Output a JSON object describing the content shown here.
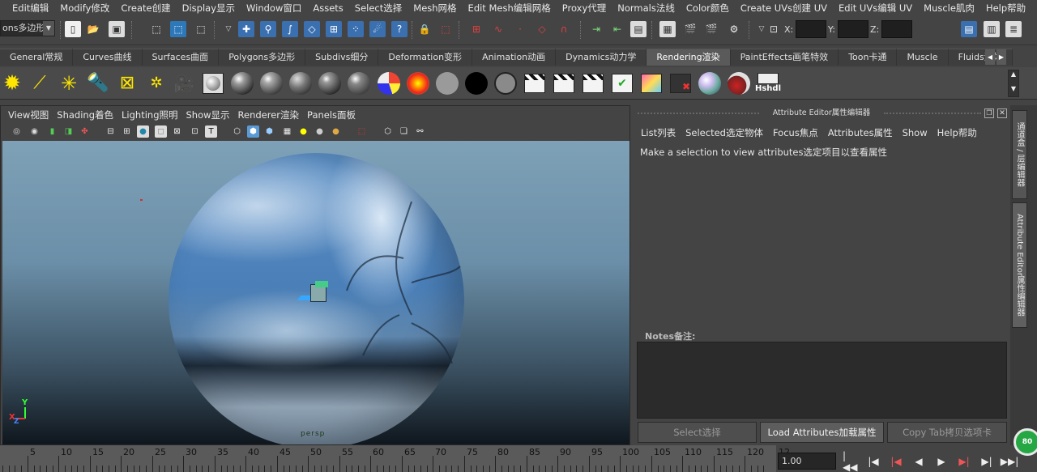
{
  "menubar": {
    "items": [
      "Edit编辑",
      "Modify修改",
      "Create创建",
      "Display显示",
      "Window窗口",
      "Assets",
      "Select选择",
      "Mesh网格",
      "Edit Mesh编辑网格",
      "Proxy代理",
      "Normals法线",
      "Color颜色",
      "Create UVs创建 UV",
      "Edit UVs编辑 UV",
      "Muscle肌肉",
      "Help帮助"
    ]
  },
  "statusline": {
    "mode_value": "ons多边形",
    "coord_labels": {
      "x": "X:",
      "y": "Y:",
      "z": "Z:"
    }
  },
  "shelf": {
    "tabs": [
      "General常规",
      "Curves曲线",
      "Surfaces曲面",
      "Polygons多边形",
      "Subdivs细分",
      "Deformation变形",
      "Animation动画",
      "Dynamics动力学",
      "Rendering渲染",
      "PaintEffects画笔特效",
      "Toon卡通",
      "Muscle",
      "Fluids流体"
    ],
    "active_tab": "Rendering渲染",
    "hshd_label": "Hshdl"
  },
  "viewport": {
    "menu": [
      "View视图",
      "Shading着色",
      "Lighting照明",
      "Show显示",
      "Renderer渲染",
      "Panels面板"
    ],
    "camera_label": "persp",
    "axis": {
      "y": "Y",
      "x": "X",
      "z": "Z"
    }
  },
  "attribute_editor": {
    "title": "Attribute Editor属性编辑器",
    "menu": [
      "List列表",
      "Selected选定物体",
      "Focus焦点",
      "Attributes属性",
      "Show",
      "Help帮助"
    ],
    "message": "Make a selection to view attributes选定项目以查看属性",
    "notes_label": "Notes备注:",
    "buttons": {
      "select": "Select选择",
      "load": "Load Attributes加载属性",
      "copy_tab": "Copy Tab拷贝选项卡"
    }
  },
  "side_tabs": {
    "channel_box": "通道盒 / 层编辑器",
    "attribute_editor": "Attribute Editor属性编辑器"
  },
  "timeslider": {
    "labels": [
      "5",
      "10",
      "15",
      "20",
      "25",
      "30",
      "35",
      "40",
      "45",
      "50",
      "55",
      "60",
      "65",
      "70",
      "75",
      "80",
      "85",
      "90",
      "95",
      "100",
      "105",
      "110",
      "115",
      "120",
      "12"
    ],
    "current_frame": "1.00"
  },
  "badge": "80",
  "colors": {
    "ui_bg": "#444444",
    "active_tab": "#5a5a5a",
    "timeline": "#5a5a5a",
    "badge_green": "#25a844"
  }
}
